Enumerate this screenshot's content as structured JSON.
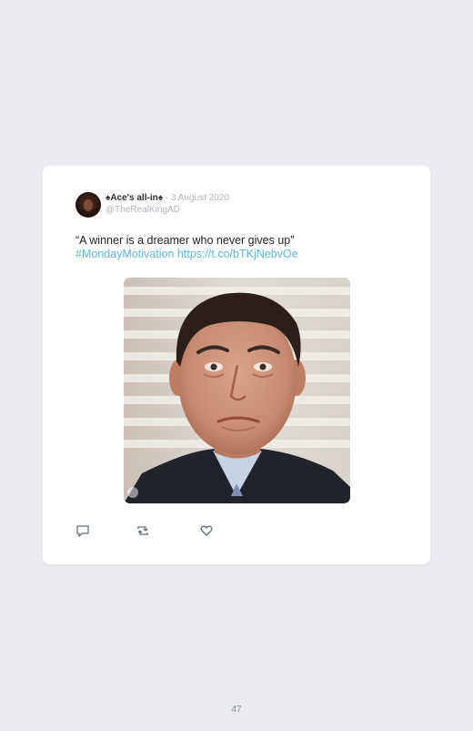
{
  "tweet": {
    "display_name": "♠Ace's all-in♠",
    "separator": "·",
    "date": "3 August 2020",
    "handle": "@TheRealKingAD",
    "text_line1": "“A winner is a dreamer who never gives up”",
    "hashtag": "#MondayMotivation",
    "link": "https://t.co/bTKjNebvOe",
    "media": {
      "description": "Man in suit with teary eyes"
    }
  },
  "actions": {
    "reply_icon": "reply-icon",
    "retweet_icon": "retweet-icon",
    "like_icon": "like-icon"
  },
  "page": {
    "number": "47"
  },
  "colors": {
    "background": "#e9ebef",
    "card": "#ffffff",
    "link": "#5ab7e8",
    "icon": "#5f6f7a"
  }
}
